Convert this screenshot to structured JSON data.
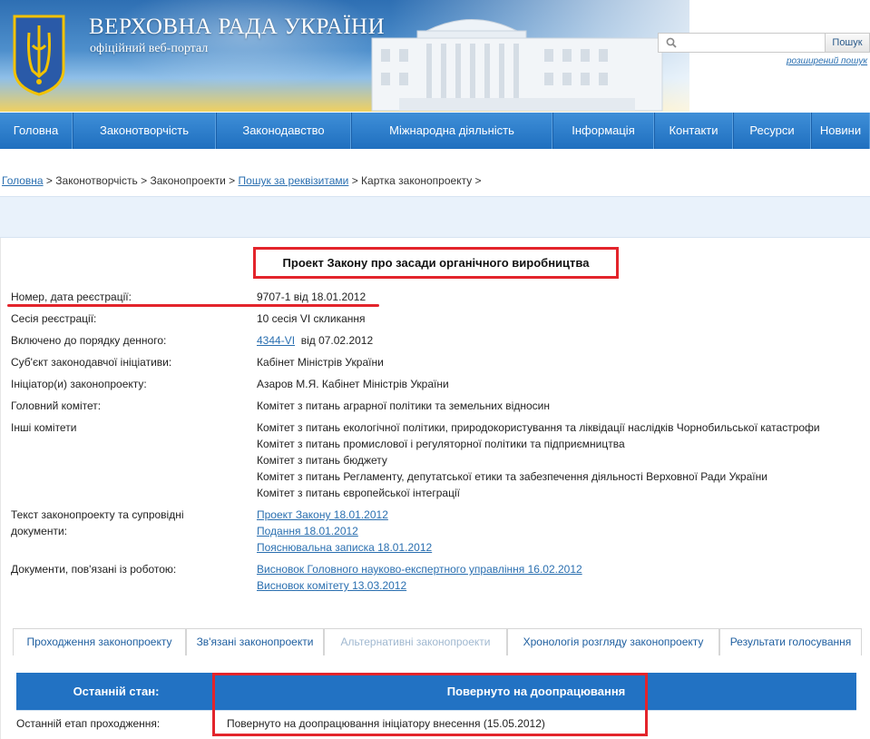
{
  "header": {
    "title": "ВЕРХОВНА РАДА УКРАЇНИ",
    "subtitle": "офіційний веб-портал",
    "search_placeholder": "",
    "search_button": "Пошук",
    "advanced_search": "розширений пошук"
  },
  "nav": [
    {
      "label": "Головна"
    },
    {
      "label": "Законотворчість"
    },
    {
      "label": "Законодавство"
    },
    {
      "label": "Міжнародна діяльність"
    },
    {
      "label": "Інформація"
    },
    {
      "label": "Контакти"
    },
    {
      "label": "Ресурси"
    },
    {
      "label": "Новини"
    }
  ],
  "breadcrumb": {
    "home": "Головна",
    "sep1": " > Законотворчість > Законопроекти > ",
    "search": "Пошук за реквізитами",
    "sep2": " > Картка законопроекту >"
  },
  "bill": {
    "title": "Проект Закону про засади органічного виробництва",
    "rows": {
      "reg": {
        "label": "Номер, дата реєстрації:",
        "value": "9707-1 від 18.01.2012"
      },
      "session": {
        "label": "Сесія реєстрації:",
        "value": "10 сесія VI скликання"
      },
      "agenda": {
        "label": "Включено до порядку денного:",
        "link": "4344-VI",
        "rest": "від 07.02.2012"
      },
      "subject": {
        "label": "Суб'єкт законодавчої ініціативи:",
        "value": "Кабінет Міністрів України"
      },
      "initiator": {
        "label": "Ініціатор(и) законопроекту:",
        "value": "Азаров М.Я. Кабінет Міністрів України"
      },
      "main_committee": {
        "label": "Головний комітет:",
        "value": "Комітет з питань аграрної політики та земельних відносин"
      },
      "other_committees": {
        "label": "Інші комітети",
        "values": [
          "Комітет з питань екологічної політики, природокористування та ліквідації наслідків Чорнобильської катастрофи",
          "Комітет з питань промислової і регуляторної політики та підприємництва",
          "Комітет з питань бюджету",
          "Комітет з питань Регламенту, депутатської етики та забезпечення діяльності Верховної Ради України",
          "Комітет з питань європейської інтеграції"
        ]
      },
      "texts": {
        "label_line1": "Текст законопроекту та супровідні",
        "label_line2": "документи:",
        "links": [
          "Проект Закону 18.01.2012",
          "Подання 18.01.2012",
          "Пояснювальна записка 18.01.2012"
        ]
      },
      "docs": {
        "label": "Документи, пов'язані із роботою:",
        "links": [
          "Висновок Головного науково-експертного управління 16.02.2012",
          "Висновок комітету 13.03.2012"
        ]
      }
    }
  },
  "tabs": [
    {
      "label": "Проходження законопроекту"
    },
    {
      "label": "Зв'язані законопроекти"
    },
    {
      "label": "Альтернативні законопроекти"
    },
    {
      "label": "Хронологія розгляду законопроекту"
    },
    {
      "label": "Результати голосування"
    }
  ],
  "status": {
    "last_state_label": "Останній стан:",
    "last_state_value": "Повернуто на доопрацювання",
    "stage_label": "Останній етап проходження:",
    "stage_value": "Повернуто на доопрацювання ініціатору внесення (15.05.2012)"
  },
  "colors": {
    "nav": "#2272c3",
    "accent_red": "#e3242b",
    "link": "#2a6fb0"
  }
}
